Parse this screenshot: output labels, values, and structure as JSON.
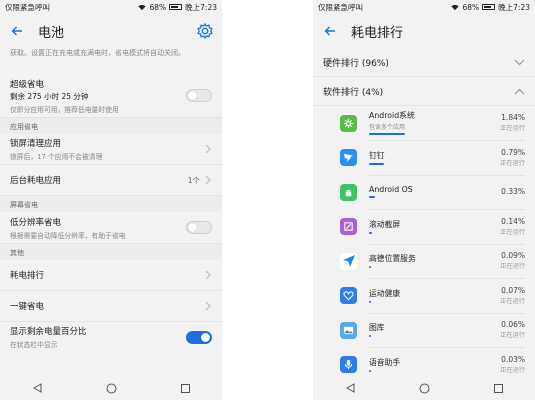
{
  "status_bar": {
    "carrier": "仅限紧急呼叫",
    "battery_level": "68%",
    "time": "晚上7:23"
  },
  "left": {
    "title": "电池",
    "partial_description": "动，减弱或关闭部分视觉效果和系统提示音，关闭邮件后台自动获取。设置正在充电或充满电时，省电模式将自动关闭。",
    "super_saver": {
      "title": "超级省电",
      "remaining": "剩余 275 小时 25 分钟",
      "description": "仅即分应用可用，推荐低电量时使用"
    },
    "section_app_saving": "应用省电",
    "lockscreen_cleanup": {
      "title": "锁屏清理应用",
      "description": "锁屏后，17 个应用不会被清理"
    },
    "background_apps": {
      "title": "后台耗电应用",
      "count": "1个"
    },
    "section_screen_saving": "屏幕省电",
    "low_resolution": {
      "title": "低分辨率省电",
      "description": "根据需要自动降低分辨率，有助于省电"
    },
    "section_other": "其他",
    "consumption_rank": "耗电排行",
    "one_tap_saver": "一键省电",
    "show_percentage": {
      "title": "显示剩余电量百分比",
      "description": "在状态栏中显示",
      "enabled": true
    }
  },
  "right": {
    "title": "耗电排行",
    "hardware_group": "硬件排行 (96%)",
    "software_group": "软件排行 (4%)",
    "apps": [
      {
        "name": "Android系统",
        "sub": "包含多个应用",
        "percent": "1.84%",
        "status": "正在运行",
        "icon": "android-system-icon",
        "color": "#5bbb4a",
        "share": 1.84
      },
      {
        "name": "钉钉",
        "sub": "",
        "percent": "0.79%",
        "status": "正在运行",
        "icon": "dingtalk-icon",
        "color": "#2b8ef0",
        "share": 0.79
      },
      {
        "name": "Android OS",
        "sub": "",
        "percent": "0.33%",
        "status": "",
        "icon": "android-os-icon",
        "color": "#3ec36a",
        "share": 0.33
      },
      {
        "name": "滚动截屏",
        "sub": "",
        "percent": "0.14%",
        "status": "正在运行",
        "icon": "scroll-screenshot-icon",
        "color": "#a861d6",
        "share": 0.14
      },
      {
        "name": "高德位置服务",
        "sub": "",
        "percent": "0.09%",
        "status": "正在运行",
        "icon": "location-service-icon",
        "color": "#ffffff",
        "share": 0.09
      },
      {
        "name": "运动健康",
        "sub": "",
        "percent": "0.07%",
        "status": "正在运行",
        "icon": "health-icon",
        "color": "#2f7ee6",
        "share": 0.07
      },
      {
        "name": "图库",
        "sub": "",
        "percent": "0.06%",
        "status": "正在运行",
        "icon": "gallery-icon",
        "color": "#5aa7e8",
        "share": 0.06
      },
      {
        "name": "语音助手",
        "sub": "",
        "percent": "0.03%",
        "status": "正在运行",
        "icon": "voice-assistant-icon",
        "color": "#2f7ee6",
        "share": 0.03
      }
    ]
  },
  "colors": {
    "accent": "#1e6fdc",
    "background": "#f2f2f2"
  }
}
